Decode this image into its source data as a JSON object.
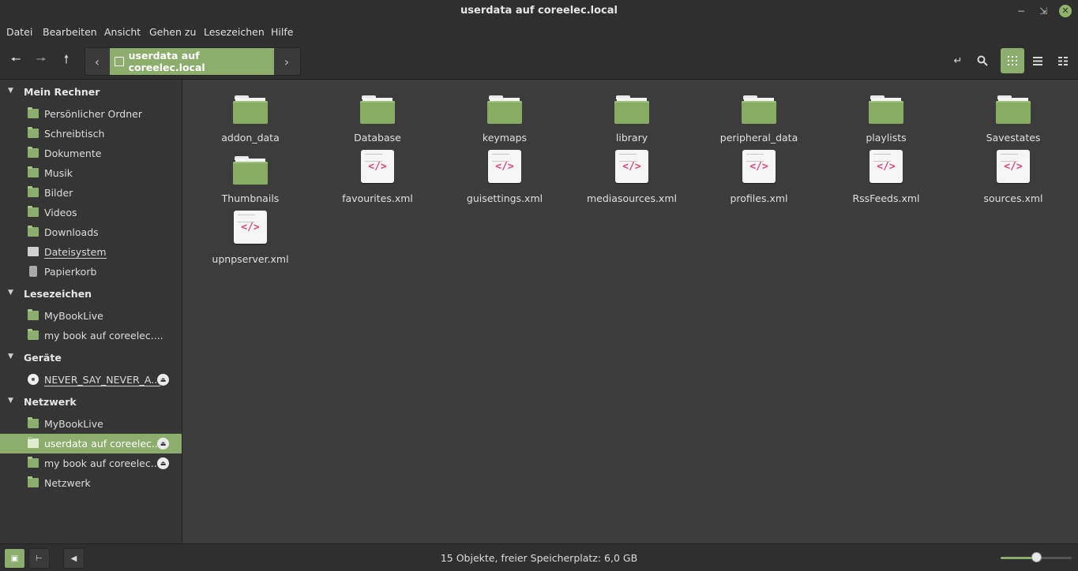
{
  "window": {
    "title": "userdata auf coreelec.local",
    "minimize_icon": "minimize-icon",
    "maximize_icon": "maximize-icon",
    "close_icon": "close-icon"
  },
  "menu": [
    "Datei",
    "Bearbeiten",
    "Ansicht",
    "Gehen zu",
    "Lesezeichen",
    "Hilfe"
  ],
  "toolbar": {
    "path_segment": "userdata auf coreelec.local",
    "icons": [
      "back-icon",
      "forward-icon",
      "up-icon",
      "path-left-icon",
      "path-right-icon",
      "toggle-location-icon",
      "search-icon",
      "icon-view-icon",
      "list-view-icon",
      "compact-view-icon"
    ]
  },
  "sidebar": {
    "sections": [
      {
        "title": "Mein Rechner",
        "items": [
          {
            "label": "Persönlicher Ordner",
            "icon": "home-folder-icon"
          },
          {
            "label": "Schreibtisch",
            "icon": "desktop-folder-icon"
          },
          {
            "label": "Dokumente",
            "icon": "documents-folder-icon"
          },
          {
            "label": "Musik",
            "icon": "music-folder-icon"
          },
          {
            "label": "Bilder",
            "icon": "pictures-folder-icon"
          },
          {
            "label": "Videos",
            "icon": "videos-folder-icon"
          },
          {
            "label": "Downloads",
            "icon": "downloads-folder-icon"
          },
          {
            "label": "Dateisystem",
            "icon": "filesystem-icon"
          },
          {
            "label": "Papierkorb",
            "icon": "trash-icon"
          }
        ]
      },
      {
        "title": "Lesezeichen",
        "items": [
          {
            "label": "MyBookLive",
            "icon": "folder-icon"
          },
          {
            "label": "my book auf coreelec....",
            "icon": "network-folder-icon"
          }
        ]
      },
      {
        "title": "Geräte",
        "items": [
          {
            "label": "NEVER_SAY_NEVER_A...",
            "icon": "disc-icon"
          }
        ]
      },
      {
        "title": "Netzwerk",
        "items": [
          {
            "label": "MyBookLive",
            "icon": "network-folder-icon"
          },
          {
            "label": "userdata auf coreelec....",
            "icon": "network-folder-icon"
          },
          {
            "label": "my book auf coreelec....",
            "icon": "network-folder-icon"
          },
          {
            "label": "Netzwerk",
            "icon": "network-icon"
          }
        ]
      }
    ]
  },
  "files": [
    {
      "name": "addon_data",
      "type": "folder"
    },
    {
      "name": "Database",
      "type": "folder"
    },
    {
      "name": "keymaps",
      "type": "folder"
    },
    {
      "name": "library",
      "type": "folder"
    },
    {
      "name": "peripheral_data",
      "type": "folder"
    },
    {
      "name": "playlists",
      "type": "folder"
    },
    {
      "name": "Savestates",
      "type": "folder"
    },
    {
      "name": "Thumbnails",
      "type": "folder"
    },
    {
      "name": "favourites.xml",
      "type": "xml"
    },
    {
      "name": "guisettings.xml",
      "type": "xml"
    },
    {
      "name": "mediasources.xml",
      "type": "xml"
    },
    {
      "name": "profiles.xml",
      "type": "xml"
    },
    {
      "name": "RssFeeds.xml",
      "type": "xml"
    },
    {
      "name": "sources.xml",
      "type": "xml"
    },
    {
      "name": "upnpserver.xml",
      "type": "xml"
    }
  ],
  "xml_glyph": "</>",
  "status": {
    "text": "15 Objekte, freier Speicherplatz: 6,0 GB",
    "zoom_level": 0.5
  },
  "colors": {
    "accent": "#8bae6c",
    "xml_tag": "#e0447a"
  }
}
